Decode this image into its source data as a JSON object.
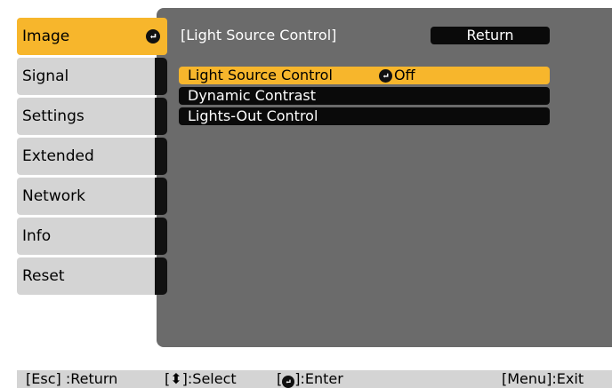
{
  "sidebar": {
    "items": [
      {
        "label": "Image",
        "active": true
      },
      {
        "label": "Signal"
      },
      {
        "label": "Settings"
      },
      {
        "label": "Extended"
      },
      {
        "label": "Network"
      },
      {
        "label": "Info"
      },
      {
        "label": "Reset"
      }
    ]
  },
  "panel": {
    "title": "[Light Source Control]",
    "return_label": "Return",
    "options": [
      {
        "label": "Light Source Control",
        "value": "Off",
        "active": true
      },
      {
        "label": "Dynamic Contrast"
      },
      {
        "label": "Lights-Out Control"
      }
    ]
  },
  "footer": {
    "esc": "[Esc] :Return",
    "select_open": "[",
    "select_icon": "⬍",
    "select_close": "]:Select",
    "enter_open": "[",
    "enter_close": "]:Enter",
    "exit": "[Menu]:Exit"
  },
  "colors": {
    "accent": "#f7b62c",
    "panel_bg": "#6b6b6b",
    "sidebar_bg": "#d4d4d4",
    "bar_bg": "#0a0a0a"
  }
}
